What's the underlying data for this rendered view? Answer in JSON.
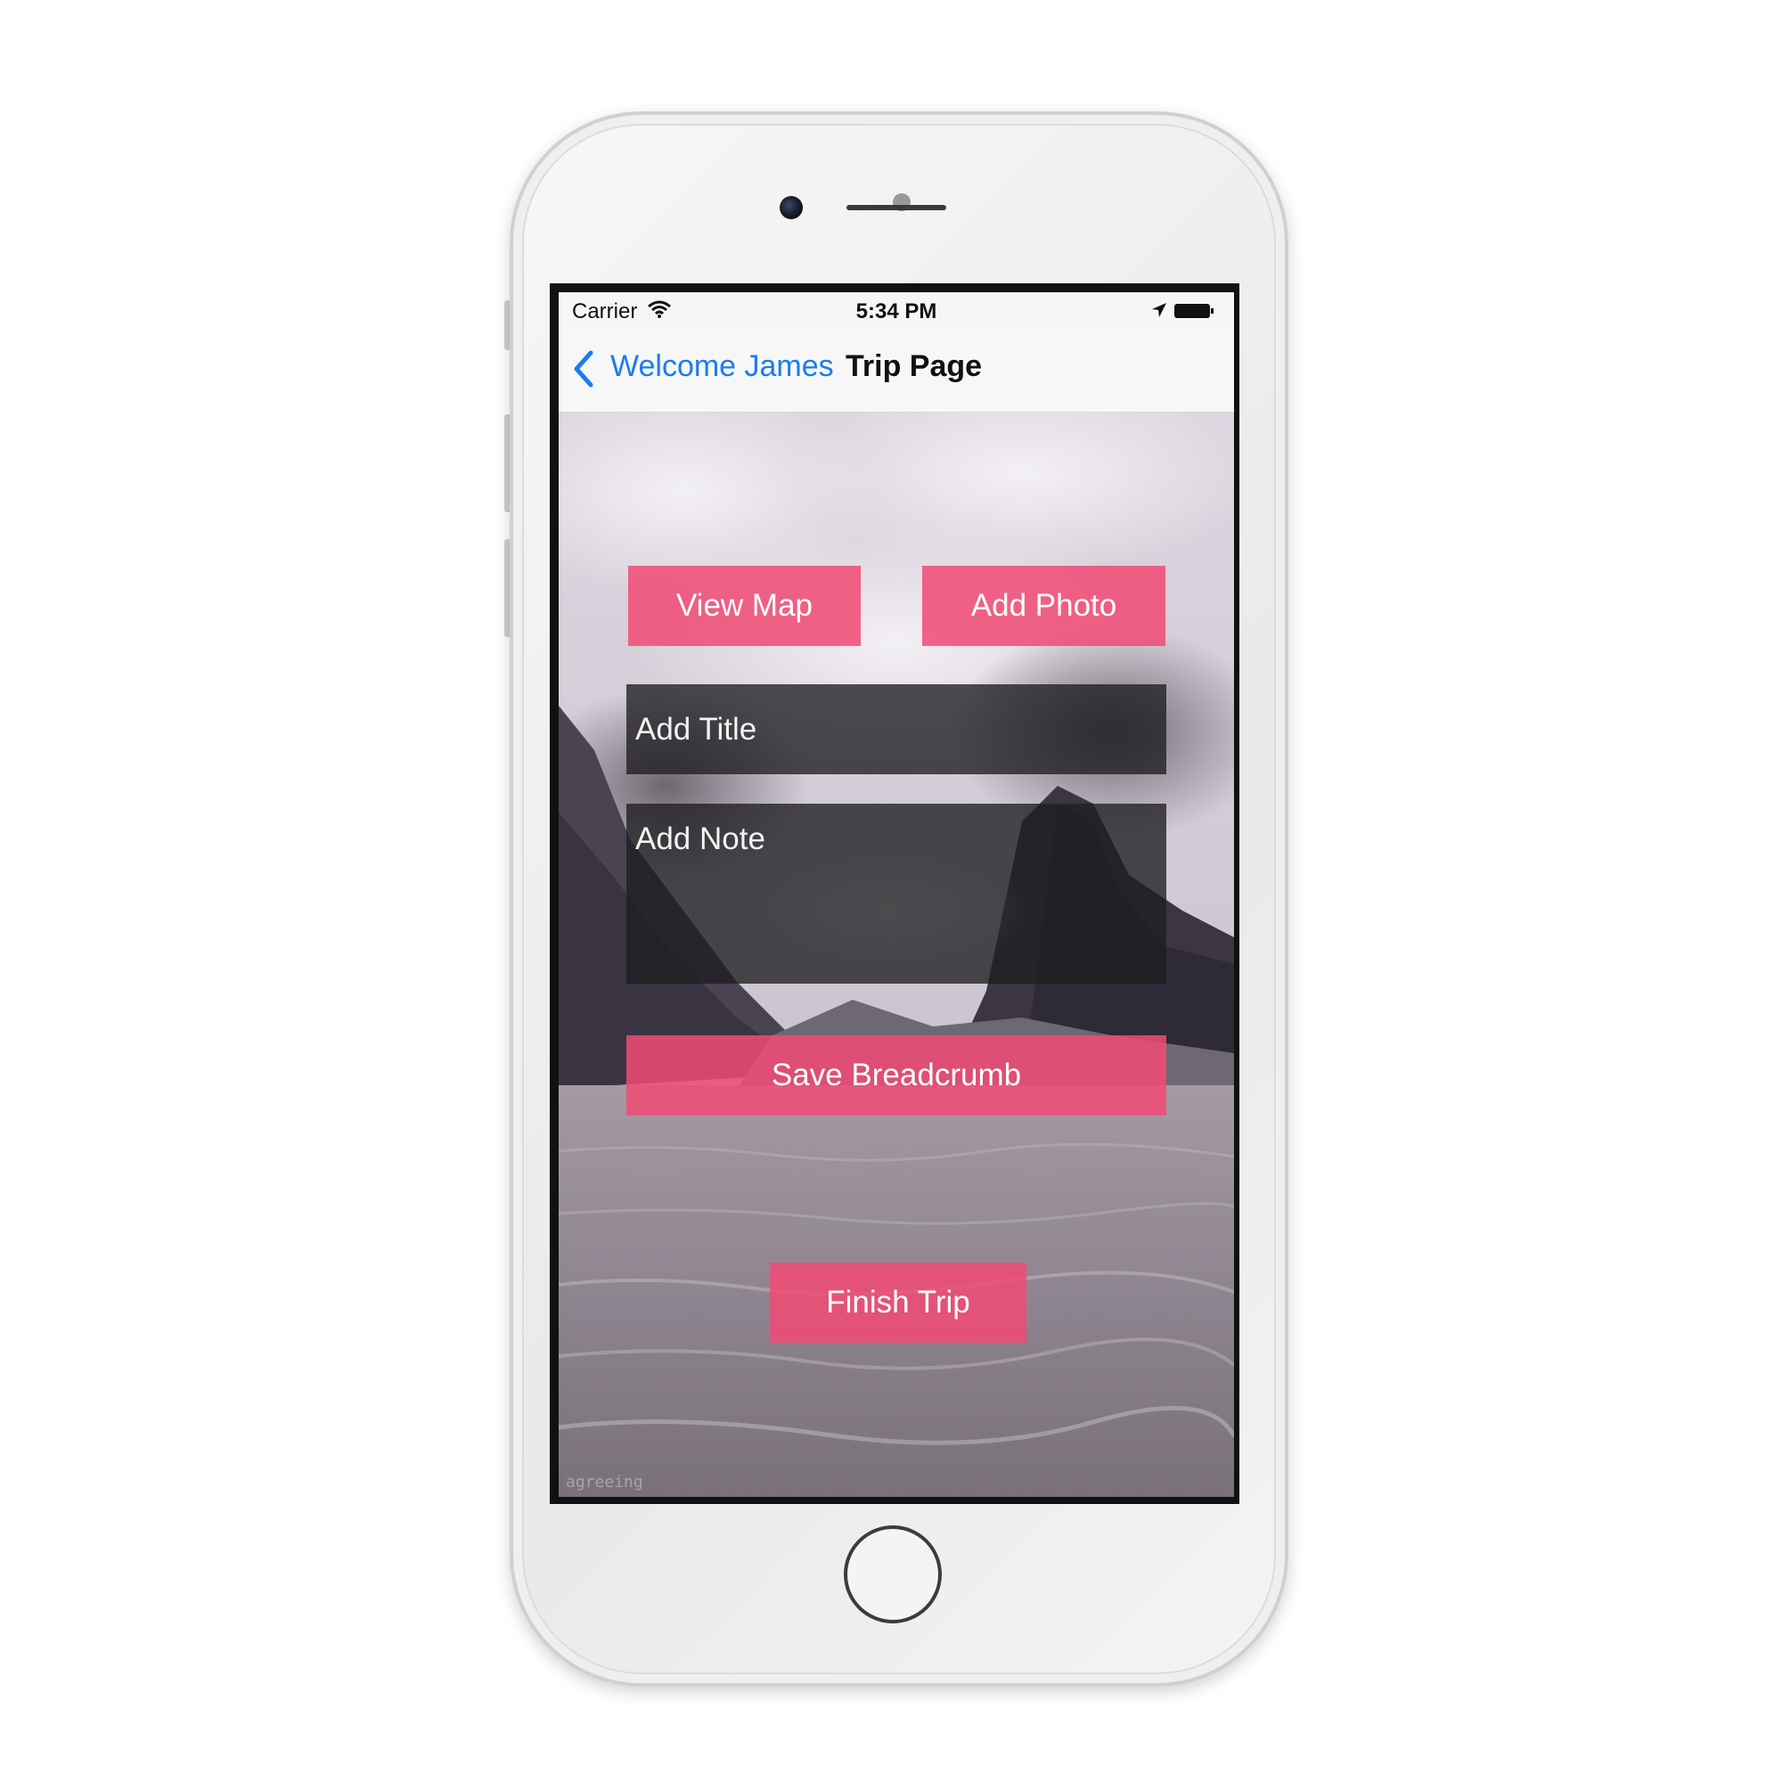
{
  "status_bar": {
    "carrier": "Carrier",
    "time": "5:34 PM",
    "wifi_icon": "wifi-icon",
    "location_icon": "location-arrow-icon",
    "battery_icon": "battery-icon"
  },
  "nav": {
    "back_label": "Welcome James",
    "back_icon": "chevron-left-icon",
    "title": "Trip Page",
    "tint_color": "#1a7cf0"
  },
  "main": {
    "view_map_label": "View Map",
    "add_photo_label": "Add Photo",
    "title_placeholder": "Add Title",
    "note_placeholder": "Add Note",
    "save_breadcrumb_label": "Save Breadcrumb",
    "finish_trip_label": "Finish Trip",
    "button_color": "#f14a74",
    "field_color": "#1e1e20"
  },
  "watermark": "agreeing"
}
